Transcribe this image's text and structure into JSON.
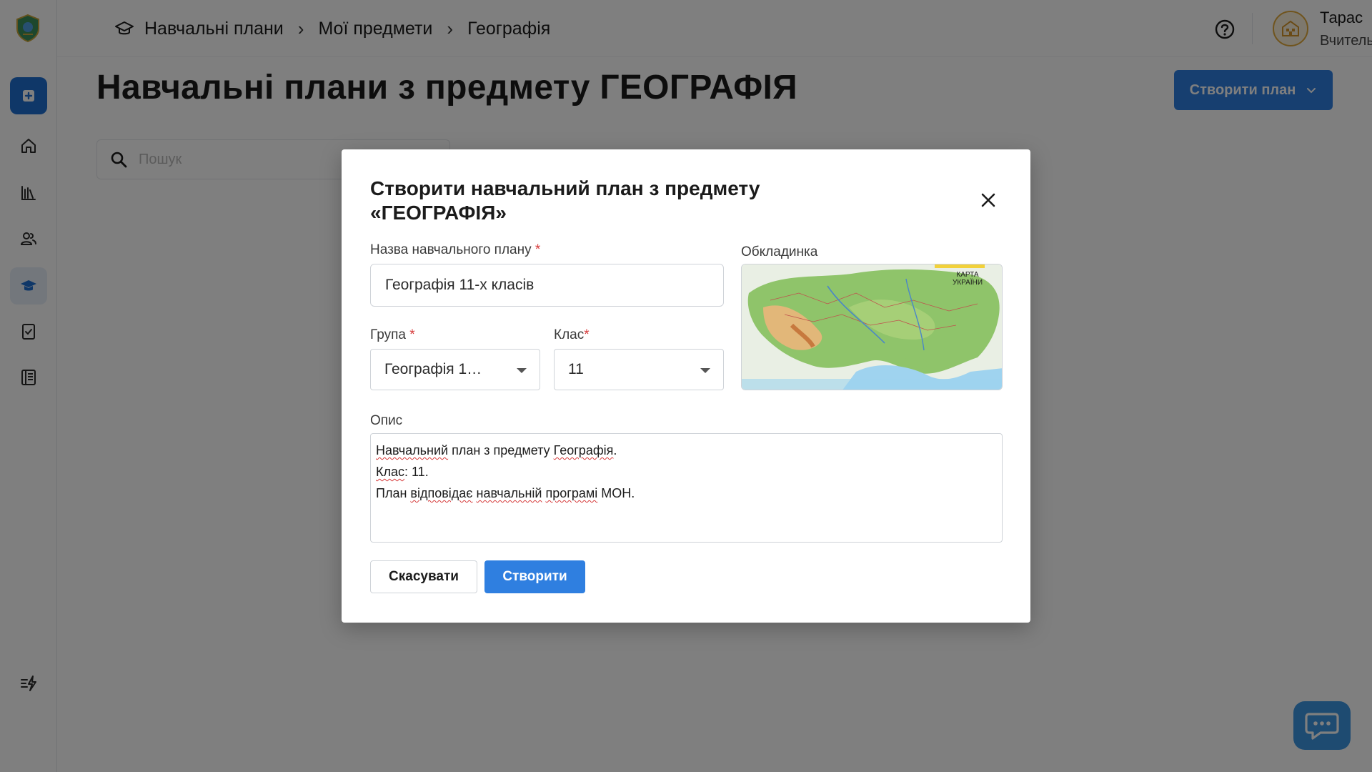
{
  "breadcrumb": {
    "items": [
      "Навчальні плани",
      "Мої предмети",
      "Географія"
    ]
  },
  "user": {
    "name": "Тарас",
    "role": "Вчитель"
  },
  "page": {
    "title": "Навчальні плани з предмету ГЕОГРАФІЯ",
    "create_button_label": "Створити план",
    "search_placeholder": "Пошук"
  },
  "modal": {
    "title": "Створити навчальний план з предмету «ГЕОГРАФІЯ»",
    "name_label": "Назва навчального плану",
    "name_value": "Географія 11-х класів",
    "cover_label": "Обкладинка",
    "cover_map_text_line1": "КАРТА",
    "cover_map_text_line2": "УКРАЇНИ",
    "group_label": "Група",
    "group_value": "Географія 1…",
    "class_label": "Клас",
    "class_value": "11",
    "description_label": "Опис",
    "description_lines": [
      "Навчальний план з предмету Географія.",
      "Клас: 11.",
      "План відповідає навчальній програмі МОН."
    ],
    "cancel_label": "Скасувати",
    "submit_label": "Створити",
    "required_mark": "*"
  },
  "colors": {
    "primary": "#2f7fe0",
    "required": "#d63a3a",
    "overlay": "rgba(0,0,0,0.5)"
  }
}
